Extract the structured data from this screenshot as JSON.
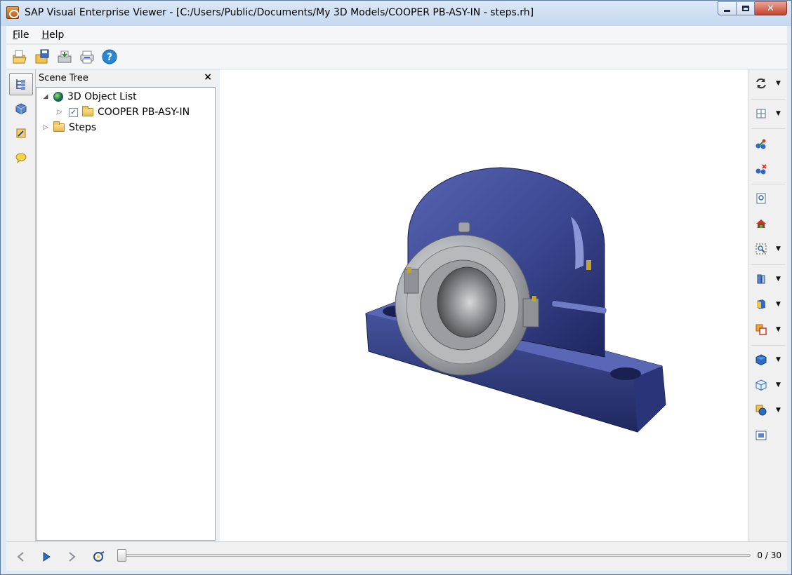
{
  "window": {
    "title": "SAP Visual Enterprise Viewer - [C:/Users/Public/Documents/My 3D Models/COOPER PB-ASY-IN - steps.rh]"
  },
  "menu": {
    "file_letter": "F",
    "file_rest": "ile",
    "help_letter": "H",
    "help_rest": "elp"
  },
  "toolbar": {
    "icons": [
      "open-icon",
      "save-icon",
      "export-icon",
      "print-icon",
      "help-icon"
    ],
    "help_glyph": "?"
  },
  "scene_tree": {
    "title": "Scene Tree",
    "close_glyph": "×",
    "items": [
      {
        "label": "3D Object List",
        "expanded": true
      },
      {
        "label": "COOPER PB-ASY-IN",
        "checked": true,
        "check_glyph": "✓"
      },
      {
        "label": "Steps",
        "expanded": false
      }
    ],
    "expanded_glyph": "◢",
    "collapsed_glyph": "▷"
  },
  "viewport": {
    "model": "pillow-block-bearing"
  },
  "timeline": {
    "current_step": 0,
    "total_steps": 30,
    "counter_text": "0 / 30"
  },
  "colors": {
    "housing": "#3f4c96",
    "bearing": "#b9bcbf",
    "accent": "#2f6bbf"
  }
}
